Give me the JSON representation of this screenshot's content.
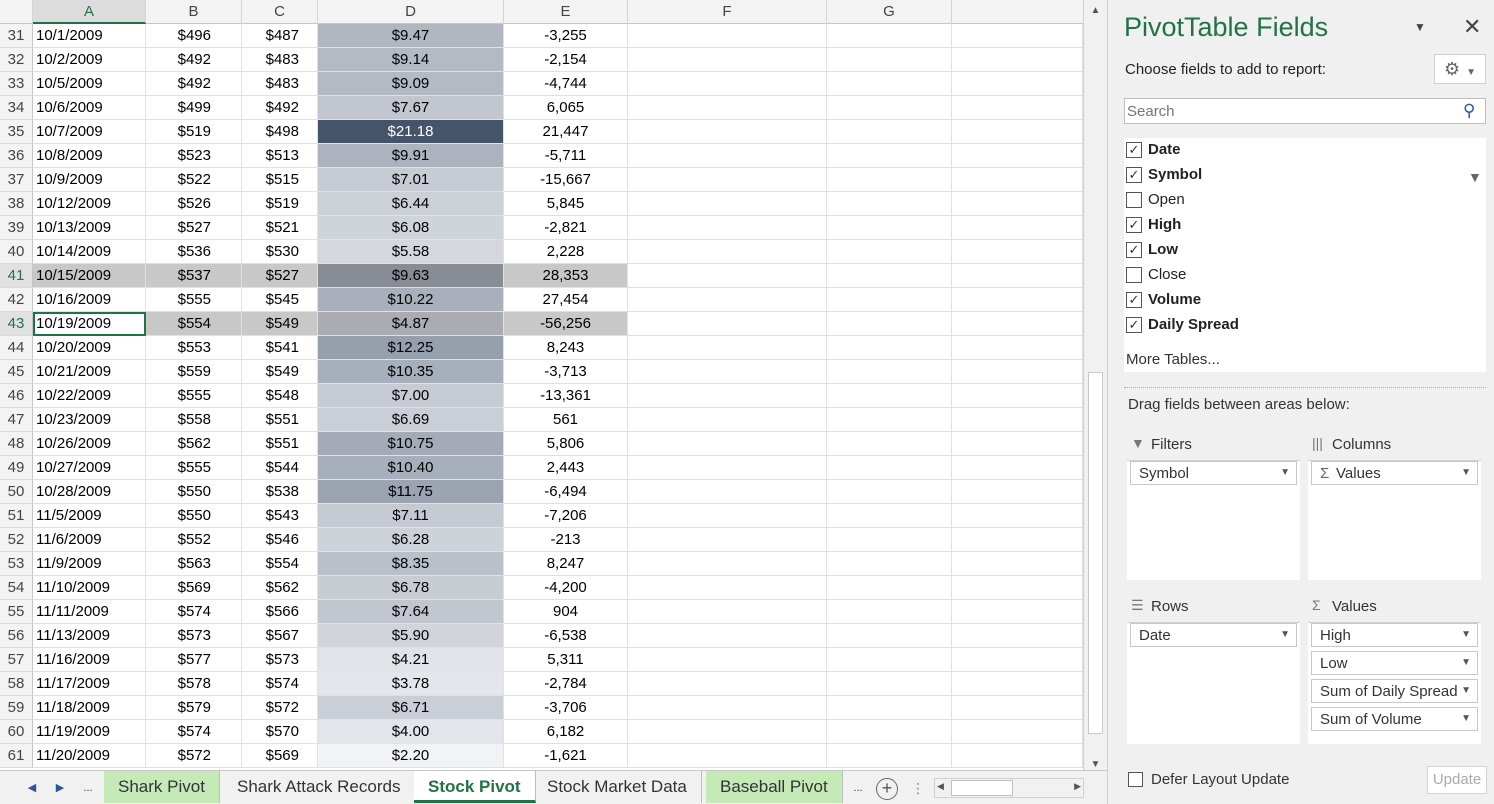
{
  "columns": [
    "A",
    "B",
    "C",
    "D",
    "E",
    "F",
    "G"
  ],
  "selected_column": "A",
  "active_cell": "A43",
  "rows": [
    {
      "n": "31",
      "a": "10/1/2009",
      "b": "$496",
      "c": "$487",
      "d": "$9.47",
      "e": "-3,255",
      "shade": 0.38
    },
    {
      "n": "32",
      "a": "10/2/2009",
      "b": "$492",
      "c": "$483",
      "d": "$9.14",
      "e": "-2,154",
      "shade": 0.36
    },
    {
      "n": "33",
      "a": "10/5/2009",
      "b": "$492",
      "c": "$483",
      "d": "$9.09",
      "e": "-4,744",
      "shade": 0.36
    },
    {
      "n": "34",
      "a": "10/6/2009",
      "b": "$499",
      "c": "$492",
      "d": "$7.67",
      "e": "6,065",
      "shade": 0.28
    },
    {
      "n": "35",
      "a": "10/7/2009",
      "b": "$519",
      "c": "$498",
      "d": "$21.18",
      "e": "21,447",
      "shade": 1.0
    },
    {
      "n": "36",
      "a": "10/8/2009",
      "b": "$523",
      "c": "$513",
      "d": "$9.91",
      "e": "-5,711",
      "shade": 0.4
    },
    {
      "n": "37",
      "a": "10/9/2009",
      "b": "$522",
      "c": "$515",
      "d": "$7.01",
      "e": "-15,667",
      "shade": 0.25
    },
    {
      "n": "38",
      "a": "10/12/2009",
      "b": "$526",
      "c": "$519",
      "d": "$6.44",
      "e": "5,845",
      "shade": 0.22
    },
    {
      "n": "39",
      "a": "10/13/2009",
      "b": "$527",
      "c": "$521",
      "d": "$6.08",
      "e": "-2,821",
      "shade": 0.2
    },
    {
      "n": "40",
      "a": "10/14/2009",
      "b": "$536",
      "c": "$530",
      "d": "$5.58",
      "e": "2,228",
      "shade": 0.17
    },
    {
      "n": "41",
      "a": "10/15/2009",
      "b": "$537",
      "c": "$527",
      "d": "$9.63",
      "e": "28,353",
      "shade": 0.39,
      "hl": true
    },
    {
      "n": "42",
      "a": "10/16/2009",
      "b": "$555",
      "c": "$545",
      "d": "$10.22",
      "e": "27,454",
      "shade": 0.42
    },
    {
      "n": "43",
      "a": "10/19/2009",
      "b": "$554",
      "c": "$549",
      "d": "$4.87",
      "e": "-56,256",
      "shade": 0.14,
      "hl": true
    },
    {
      "n": "44",
      "a": "10/20/2009",
      "b": "$553",
      "c": "$541",
      "d": "$12.25",
      "e": "8,243",
      "shade": 0.53
    },
    {
      "n": "45",
      "a": "10/21/2009",
      "b": "$559",
      "c": "$549",
      "d": "$10.35",
      "e": "-3,713",
      "shade": 0.43
    },
    {
      "n": "46",
      "a": "10/22/2009",
      "b": "$555",
      "c": "$548",
      "d": "$7.00",
      "e": "-13,361",
      "shade": 0.25
    },
    {
      "n": "47",
      "a": "10/23/2009",
      "b": "$558",
      "c": "$551",
      "d": "$6.69",
      "e": "561",
      "shade": 0.23
    },
    {
      "n": "48",
      "a": "10/26/2009",
      "b": "$562",
      "c": "$551",
      "d": "$10.75",
      "e": "5,806",
      "shade": 0.45
    },
    {
      "n": "49",
      "a": "10/27/2009",
      "b": "$555",
      "c": "$544",
      "d": "$10.40",
      "e": "2,443",
      "shade": 0.43
    },
    {
      "n": "50",
      "a": "10/28/2009",
      "b": "$550",
      "c": "$538",
      "d": "$11.75",
      "e": "-6,494",
      "shade": 0.5
    },
    {
      "n": "51",
      "a": "11/5/2009",
      "b": "$550",
      "c": "$543",
      "d": "$7.11",
      "e": "-7,206",
      "shade": 0.26
    },
    {
      "n": "52",
      "a": "11/6/2009",
      "b": "$552",
      "c": "$546",
      "d": "$6.28",
      "e": "-213",
      "shade": 0.21
    },
    {
      "n": "53",
      "a": "11/9/2009",
      "b": "$563",
      "c": "$554",
      "d": "$8.35",
      "e": "8,247",
      "shade": 0.32
    },
    {
      "n": "54",
      "a": "11/10/2009",
      "b": "$569",
      "c": "$562",
      "d": "$6.78",
      "e": "-4,200",
      "shade": 0.24
    },
    {
      "n": "55",
      "a": "11/11/2009",
      "b": "$574",
      "c": "$566",
      "d": "$7.64",
      "e": "904",
      "shade": 0.28
    },
    {
      "n": "56",
      "a": "11/13/2009",
      "b": "$573",
      "c": "$567",
      "d": "$5.90",
      "e": "-6,538",
      "shade": 0.19
    },
    {
      "n": "57",
      "a": "11/16/2009",
      "b": "$577",
      "c": "$573",
      "d": "$4.21",
      "e": "5,311",
      "shade": 0.1
    },
    {
      "n": "58",
      "a": "11/17/2009",
      "b": "$578",
      "c": "$574",
      "d": "$3.78",
      "e": "-2,784",
      "shade": 0.08
    },
    {
      "n": "59",
      "a": "11/18/2009",
      "b": "$579",
      "c": "$572",
      "d": "$6.71",
      "e": "-3,706",
      "shade": 0.23
    },
    {
      "n": "60",
      "a": "11/19/2009",
      "b": "$574",
      "c": "$570",
      "d": "$4.00",
      "e": "6,182",
      "shade": 0.09
    },
    {
      "n": "61",
      "a": "11/20/2009",
      "b": "$572",
      "c": "$569",
      "d": "$2.20",
      "e": "-1,621",
      "shade": 0.0
    }
  ],
  "heat_colors": {
    "low": "#f2f3f6",
    "high": "#44546a",
    "highlight": "#c8c8c8"
  },
  "sheet_tabs": [
    {
      "label": "Shark Pivot",
      "style": "green"
    },
    {
      "label": "Shark Attack Records",
      "style": "normal"
    },
    {
      "label": "Stock Pivot",
      "style": "active"
    },
    {
      "label": "Stock Market Data",
      "style": "normal"
    },
    {
      "label": "Baseball Pivot",
      "style": "green"
    }
  ],
  "tab_nav": {
    "prev": "◀",
    "next": "▶",
    "more": "...",
    "more_right": "...",
    "add": "+"
  },
  "panel": {
    "title": "PivotTable Fields",
    "choose_label": "Choose fields to add to report:",
    "search_placeholder": "Search",
    "fields": [
      {
        "label": "Date",
        "checked": true
      },
      {
        "label": "Symbol",
        "checked": true
      },
      {
        "label": "Open",
        "checked": false
      },
      {
        "label": "High",
        "checked": true
      },
      {
        "label": "Low",
        "checked": true
      },
      {
        "label": "Close",
        "checked": false
      },
      {
        "label": "Volume",
        "checked": true
      },
      {
        "label": "Daily Spread",
        "checked": true
      }
    ],
    "more_tables": "More Tables...",
    "drag_text": "Drag fields between areas below:",
    "filters": {
      "title": "Filters",
      "items": [
        "Symbol"
      ]
    },
    "columns": {
      "title": "Columns",
      "items": [
        "Values"
      ]
    },
    "rows": {
      "title": "Rows",
      "items": [
        "Date"
      ]
    },
    "values": {
      "title": "Values",
      "items": [
        "High",
        "Low",
        "Sum of Daily Spread",
        "Sum of Volume"
      ]
    },
    "defer_label": "Defer Layout Update",
    "update_label": "Update"
  }
}
